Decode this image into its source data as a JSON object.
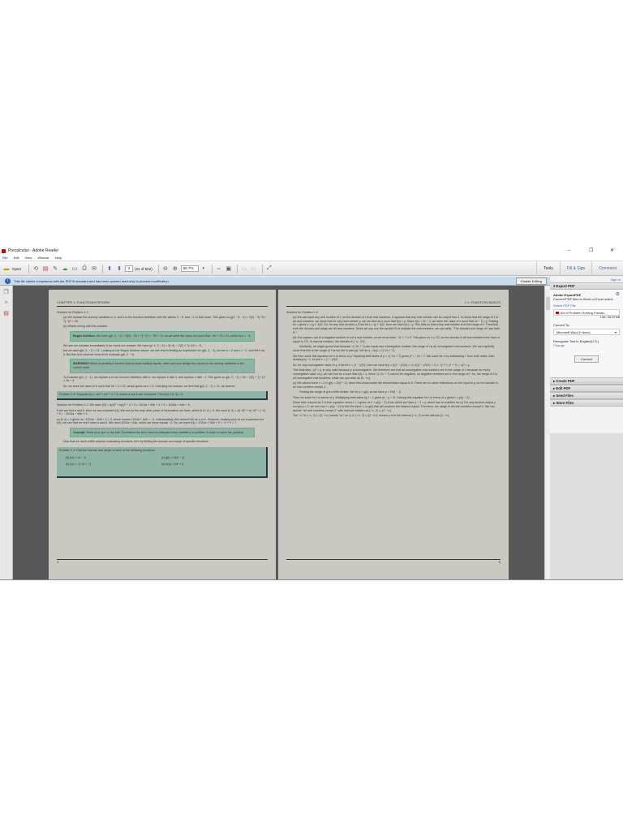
{
  "window": {
    "title": "Precalculus - Adobe Reader",
    "controls": [
      "–",
      "❐",
      "✕"
    ]
  },
  "menu": [
    "File",
    "Edit",
    "View",
    "Window",
    "Help"
  ],
  "toolbar": {
    "open": "Open",
    "page_current": "4",
    "page_total": "(21 of 502)",
    "zoom": "55.7%",
    "tabs": [
      "Tools",
      "Fill & Sign",
      "Comment"
    ]
  },
  "infobar": {
    "message": "This file claims compliance with the PDF/A standard and has been opened read-only to prevent modification.",
    "button": "Enable Editing"
  },
  "right_panel": {
    "sign_in": "Sign In",
    "export_header": "Export PDF",
    "export_title": "Adobe ExportPDF",
    "export_desc": "Convert PDF files to Word or Excel online.",
    "select_label": "Select PDF File",
    "file_name": "Art of Problem Solving Precalc...",
    "file_info": "1 file / 56.09 MB",
    "convert_to_label": "Convert To:",
    "convert_to_value": "Microsoft Word (*.docx)",
    "recognize": "Recognize Text in English(U.S.)",
    "change": "Change",
    "convert_button": "Convert",
    "sections": [
      "Create PDF",
      "Edit PDF",
      "Send Files",
      "Store Files"
    ]
  },
  "page_left": {
    "header": "CHAPTER 1. FUNCTIONS REVIEW",
    "sol_title": "Solution for Problem 1.2:",
    "a": "(a) We replace the dummy variables a, b, and c in the function definition with the values 3, −5, and −1, in that order. This gives us g(3, −5, −1) = 2(3) − 3(−5) + 7(−1)² = 28.",
    "b": "(b) What's wrong with this solution:",
    "bogus_label": "Bogus Solution:",
    "bogus_text": "We have g(b, 2, −1) = 3(2) − 2b + 7(−1)² = −2b + 13, so we seek the value of b such that −2b + 13 = 21, which is b = −4.",
    "check": "We see our mistake immediately if we check our answer. We have g(−4, 2, −1) = 3(−4) − 2(2) + 7(−1)² = −9,",
    "but": "but we want g(b, 2, −1) = 21. Looking at our Bogus Solution above, we see that in finding an expression for g(b, 2, −1), we set a = 2 and c = −1, and left b as b. But this isn't what we must do to evaluate g(b, 2, −1).",
    "warning_label": "WARNING!!",
    "warning_text": "When evaluating a function that accepts multiple inputs, make sure you assign the values to the dummy variables in the correct order.",
    "eval": "To evaluate g(b, 2, −1), we replace a in the function definition with b, we replace b with 2, and replace c with −1. This gives us g(b, 2, −1) = 3b − 2(2) + 7(−1)² = 3b + 3.",
    "so": "So, we seek the value of b such that 3b + 3 = 21, which gives us b = 6. Checking our answer, we find that g(6, 2, −1) = 21, as desired.",
    "problem13": "Problem 1.3: Suppose f(x) = ax⁵ + bx³ + x + 5, where a and b are constants. Find f(4) if f(−4) = 3.",
    "sol13": "Solution for Problem 1.3: We have f(4) = a(4)⁵ + b(4)³ + 4 + 5 = 1024a + 64b + 4 + 5 = 1024a + 64b + 9.",
    "sol13b": "If we can find a and b, then we can evaluate f(4). We turn to the only other piece of information we have, which is f(−4) = 3. We have f(−4) = a(−4)⁵ + b(−4)³ + (−4) + 5 = −1024a − 64b + 1.",
    "sol13c": "so f(−4) = 3 gives us −1024a − 64b + 1 = 3, which means 1024a + 64b = −2. Unfortunately, this doesn't tell us a or b. However, looking back at our expression for f(4), we see that we don't need a and b. We need 1024a + 64b, which we know equals −2. So, we have f(4) = 1024a + 64b + 9 = −2 + 9 = 7.",
    "concept_label": "Concept:",
    "concept_text": "Keep your eye on the ball. Sometimes we don't need to evaluate every variable in a problem in order to solve the problem.",
    "now": "Now that we have a little practice evaluating functions, let's try finding the domain and range of specific functions.",
    "problem14": "Problem 1.4: Find the domain and range of each of the following functions:",
    "items": [
      "(a) f(x) = 2x − 3",
      "(b) f(x) = √(−2x + 7)",
      "(c) g(t) = 2t/(t − 1)",
      "(d) h(a) = 5a² + 4"
    ],
    "page_number": "4"
  },
  "page_right": {
    "header": "1.1. FUNCTION BASICS",
    "sol_title": "Solution for Problem 1.4:",
    "a": "(a) We can input any real number to f, so the domain of f is all real numbers. It appears that any real number can be output from f. To show that the range of f is all real numbers, we show that for any real number y, we can find an x such that f(x) = y. Since f(x) = 2x − 3, we seek the value of x such that 2x − 3 = y. Solving for x gives x = (y + 3)/2. So, for any real number y, if we let x = (y + 3)/2, then we have f(x) = y. This tells us that every real number is in the range of f. Therefore, both the domain and range are all real numbers. Since we can use the symbol ℝ to indicate the real numbers, we can write, \"The domain and range of f are both ℝ.\"",
    "b": "(b) The square root of a negative number is not a real number, so we must have −2x + 7 ≥ 0. This gives us x ≤ 7/2, so the domain is all real numbers less than or equal to 7/2. In interval notation, the domain is (−∞, 7/2].",
    "b2": "Intuitively, we might guess that because √(−2x + 7) can equal any nonnegative number, the range of f is all nonnegative real numbers. We can explicitly show that this is the range of f as we did in part (a). We let y = f(x) = √(−2x + 7).",
    "b3": "We then solve this equation for x in terms of y. Squaring both sides of y = √(−2x + 7) gives y² = −2x + 7. We solve for x by subtracting 7 from both sides, then dividing by −2, to find x = (7 − y²)/2.",
    "b4": "So, for any nonnegative value of y, if we let x = (7 − y²)/2, then we have f(x) = f((7 − y²)/2) = √(−2((7 − y²)/2) + 7) = √(−7 + y² + 7) = √y² = y.",
    "b5": "This final step, √y² = y, is only valid because y is nonnegative. We therefore see that all nonnegative real numbers are in the range of f, because for every nonnegative value of y, we can find an x such that f(x) = y. Since √(−2x + 7) cannot be negative, no negative numbers are in the range of f. So, the range of f is all nonnegative real numbers, which we can write as [0, +∞).",
    "c": "(c) We cannot have t = 1 in g(t) = 2t/(t − 1), since this would make the denominator equal to 0. There are no other restrictions on the input to g, so the domain is all real numbers except 1.",
    "c2": "Finding the range of g is a little trickier. We let y = g(t), so we have y = 2t/(t − 1).",
    "c3": "Then we solve for t in terms of y. Multiplying both sides by t − 1 gives yt − y = 2t. Solving this equation for t in terms of y gives t = y/(y − 2).",
    "c4": "(Note that t cannot be 1 in this equation, since t = 1 gives us 1 = y/(y − 2), from which we have y − 2 = y, which has no solution for y.) For any desired output y except y = 2, we can use t = y/(y − 2) to find the input, t, to g(t) that will produce the desired output. Therefore, the range is all real numbers except 2. We can denote \"all real numbers except 2\" with interval notation as (−∞, 2) ∪ (2, +∞).",
    "c5": "The \"∪\" in (−∞, 2) ∪ (2, +∞) means \"or,\" so \"y ∈ (−∞, 2) ∪ (2, +∞)\" means y is in the interval (−∞, 2) or the interval (2, +∞).",
    "page_number": "5"
  }
}
